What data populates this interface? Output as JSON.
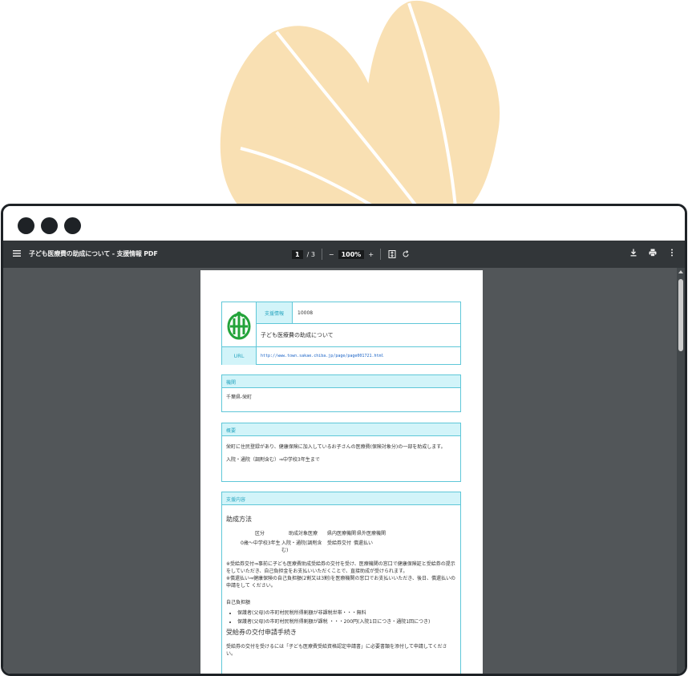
{
  "toolbar": {
    "title": "子ども医療費の助成について - 支援情報 PDF",
    "page_current": "1",
    "page_total": "/ 3",
    "zoom": "100%",
    "zoom_out": "−",
    "zoom_in": "+"
  },
  "document": {
    "label_support_info": "支援情報",
    "support_id": "10008",
    "subject": "子ども医療費の助成について",
    "url_label": "URL",
    "url_value": "http://www.town.sakae.chiba.jp/page/page001721.html",
    "agency": {
      "heading": "機関",
      "body": "千葉県-栄町"
    },
    "summary": {
      "heading": "概要",
      "line1": "栄町に住民登録があり、健康保険に加入しているお子さんの医療費(保険対象分)の一部を助成します。",
      "line2": "入院・通院（調剤含む）⇒中学校3年生まで"
    },
    "support_content": {
      "heading": "支援内容",
      "method_title": "助成方法",
      "table_header": [
        "区分",
        "助成対象医療",
        "県内医療機関",
        "県外医療機関"
      ],
      "table_row": [
        "0歳～中学校3年生",
        "入院・通院(調剤含む)",
        "受給券交付",
        "償還払い"
      ],
      "note1": "※受給券交付⇒事前に子ども医療費助成受給券の交付を受け、医療機関の窓口で健康保険証と受給券の提示をしていただき、自己負担金をお支払いいただくことで、直接助成が受けられます。",
      "note2": "※償還払い⇒健康保険の自己負担額(2割又は3割)を医療機関の窓口でお支払いいただき、後日、償還払いの申請をして ください。",
      "self_pay_title": "自己負担額",
      "bullets": [
        "保護者(父母)の市町村民税所得割額が非課税世帯・・・無料",
        "保護者(父母)の市町村民税所得割額が課税 ・・・200円(入院1日につき・通院1回につき)"
      ],
      "procedure_title": "受給券の交付申請手続き",
      "procedure_text": "受給券の交付を受けるには「子ども医療費受給資格認定申請書」に必要書類を添付して申請してください。"
    }
  }
}
